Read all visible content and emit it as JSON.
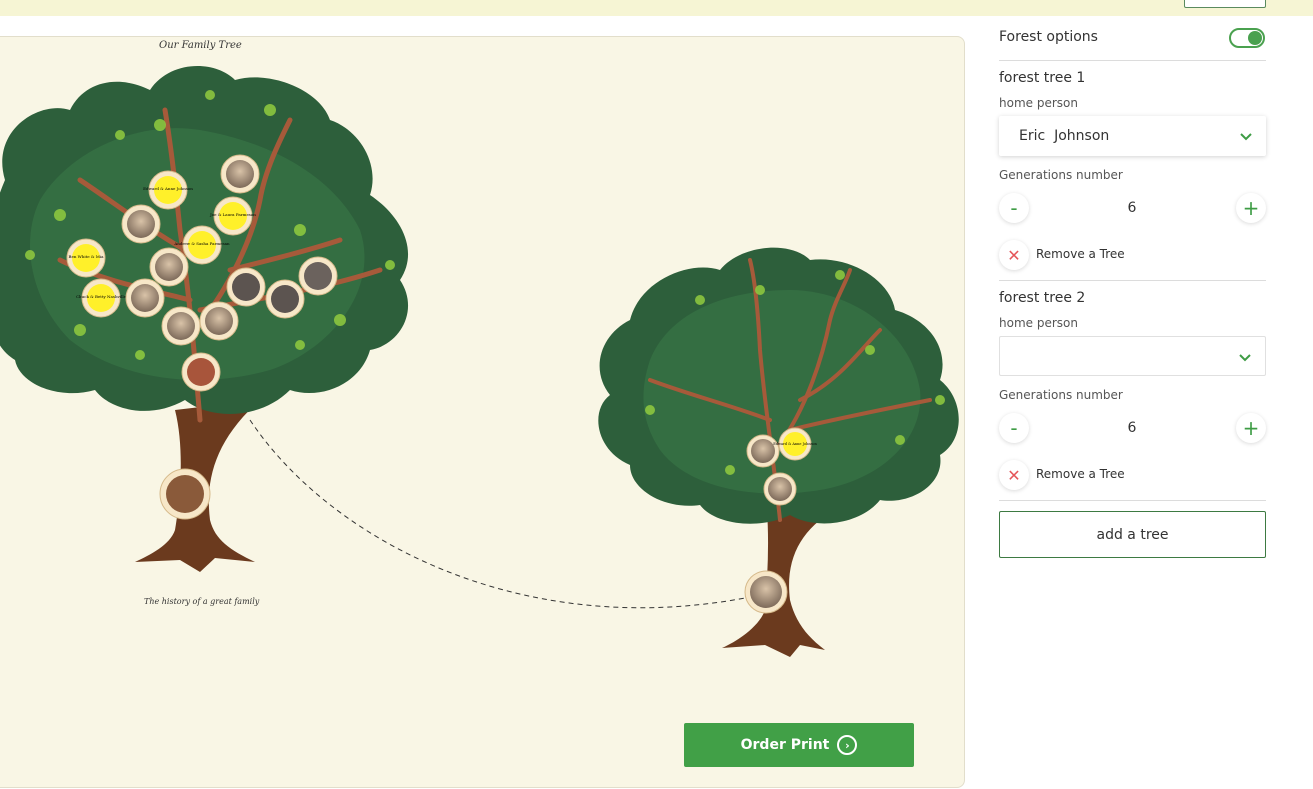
{
  "canvas": {
    "title": "Our Family Tree",
    "subtitle": "The history of a great family",
    "order_label": "Order Print",
    "order_icon": "chevron-right-circle-icon"
  },
  "tree1_nodes": [
    {
      "kind": "text",
      "text": "Edward & Anne Johnson"
    },
    {
      "kind": "photo",
      "text": ""
    },
    {
      "kind": "photo",
      "text": ""
    },
    {
      "kind": "text",
      "text": "Joe & Laura Parmesan"
    },
    {
      "kind": "text",
      "text": "Andrew & Sasha Parmesan"
    },
    {
      "kind": "text",
      "text": "Ben White & Mia"
    },
    {
      "kind": "photo",
      "text": ""
    },
    {
      "kind": "photo",
      "text": ""
    },
    {
      "kind": "photo",
      "text": ""
    },
    {
      "kind": "photo",
      "text": ""
    },
    {
      "kind": "text",
      "text": "Chuck & Betty Nashville"
    },
    {
      "kind": "photo",
      "text": ""
    },
    {
      "kind": "photo",
      "text": ""
    },
    {
      "kind": "photo",
      "text": ""
    },
    {
      "kind": "photo",
      "text": ""
    },
    {
      "kind": "photo",
      "text": ""
    }
  ],
  "tree2_nodes": [
    {
      "kind": "photo",
      "text": ""
    },
    {
      "kind": "text",
      "text": "Edward & Anne Johnson"
    },
    {
      "kind": "photo",
      "text": ""
    },
    {
      "kind": "photo",
      "text": ""
    }
  ],
  "panel": {
    "forest_options": "Forest options",
    "toggle_on": true,
    "accent": "#41a047",
    "trees": [
      {
        "heading": "forest tree 1",
        "home_label": "home person",
        "home_value": "Eric  Johnson",
        "gen_label": "Generations number",
        "gen_value": "6",
        "minus": "-",
        "plus": "+",
        "remove_label": "Remove a Tree"
      },
      {
        "heading": "forest tree 2",
        "home_label": "home person",
        "home_value": "",
        "gen_label": "Generations number",
        "gen_value": "6",
        "minus": "-",
        "plus": "+",
        "remove_label": "Remove a Tree"
      }
    ],
    "add_tree": "add a tree"
  }
}
